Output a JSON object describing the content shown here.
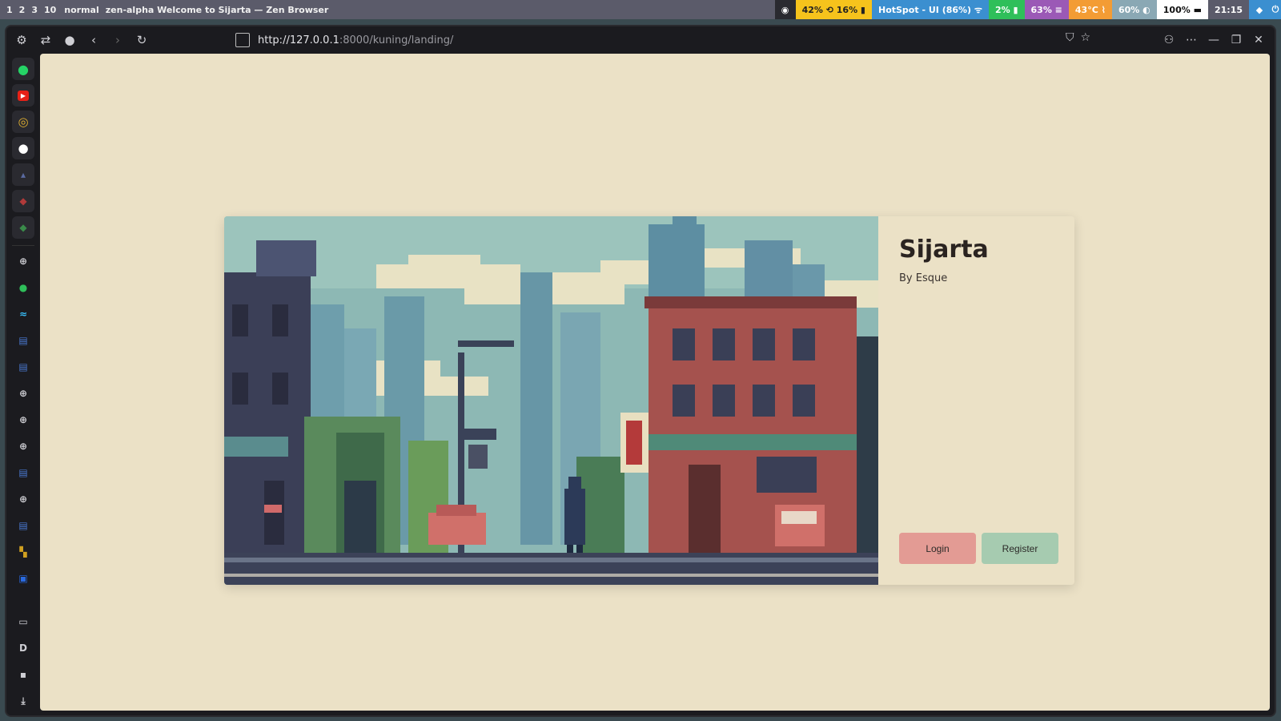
{
  "topbar": {
    "workspaces": [
      "1",
      "2",
      "3",
      "10"
    ],
    "mode": "normal",
    "window_title": "zen-alpha Welcome to Sijarta — Zen Browser",
    "modules": [
      {
        "text": "42% ⟲ 16% ▮",
        "bg": "#f6c31c",
        "fg": "#222222"
      },
      {
        "text": "HotSpot - UI (86%) ᯤ",
        "bg": "#3b8fd0",
        "fg": "#ffffff"
      },
      {
        "text": "2% ▮",
        "bg": "#2fbf5a",
        "fg": "#ffffff"
      },
      {
        "text": "63% ≡",
        "bg": "#9b59b6",
        "fg": "#ffffff"
      },
      {
        "text": "43°C ⌇",
        "bg": "#f39c34",
        "fg": "#ffffff"
      },
      {
        "text": "60% ◐",
        "bg": "#8aa8b4",
        "fg": "#ffffff"
      },
      {
        "text": "100% ▬",
        "bg": "#ffffff",
        "fg": "#111111"
      },
      {
        "text": "21:15",
        "bg": "#5b5b6a",
        "fg": "#ffffff"
      }
    ]
  },
  "browser": {
    "url_host": "http://127.0.0.1",
    "url_rest": ":8000/kuning/landing/"
  },
  "page": {
    "title": "Sijarta",
    "author": "By Esque",
    "login_label": "Login",
    "register_label": "Register"
  },
  "colors": {
    "page_bg": "#ebe1c6",
    "login_bg": "#e39b94",
    "register_bg": "#a6cbb0"
  },
  "icons": {
    "nav": [
      "gear-icon",
      "sidebar-toggle-icon",
      "globe-icon",
      "back-icon",
      "forward-icon",
      "reload-icon"
    ],
    "sidebar": [
      "whatsapp-icon",
      "youtube-icon",
      "app-icon",
      "github-icon",
      "app-icon",
      "app-icon",
      "app-icon",
      "globe-icon",
      "app-icon",
      "tailwind-icon",
      "doc-icon",
      "doc-icon",
      "globe-icon",
      "globe-icon",
      "globe-icon",
      "doc-icon",
      "globe-icon",
      "doc-icon",
      "app-icon",
      "doc-icon"
    ]
  }
}
